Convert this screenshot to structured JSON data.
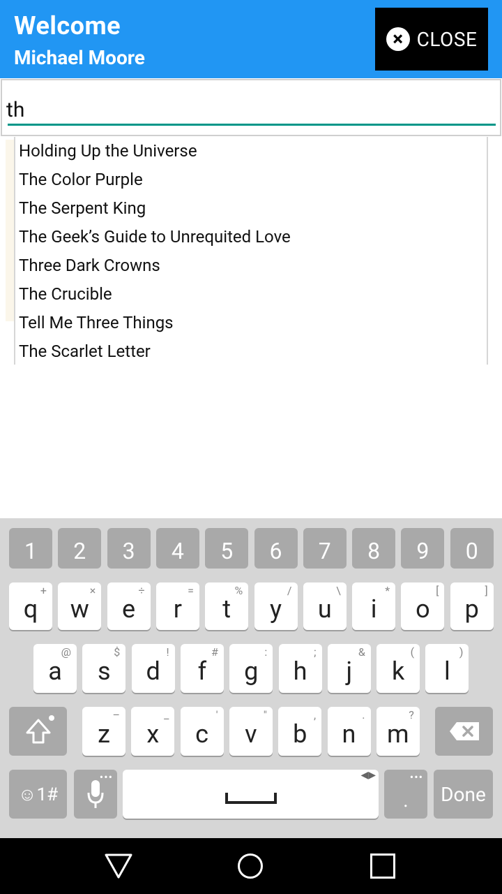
{
  "header": {
    "welcome": "Welcome",
    "username": "Michael Moore",
    "close_label": "CLOSE",
    "background": "#2196f3"
  },
  "search": {
    "value": "th",
    "accent": "#009688"
  },
  "suggestions": [
    "Holding Up the Universe",
    "The Color Purple",
    "The Serpent King",
    "The Geek’s Guide to Unrequited Love",
    "Three Dark Crowns",
    "The Crucible",
    "Tell Me Three Things",
    "The Scarlet Letter"
  ],
  "keyboard": {
    "numbers": [
      "1",
      "2",
      "3",
      "4",
      "5",
      "6",
      "7",
      "8",
      "9",
      "0"
    ],
    "row1": [
      {
        "k": "q",
        "h": "+"
      },
      {
        "k": "w",
        "h": "×"
      },
      {
        "k": "e",
        "h": "÷"
      },
      {
        "k": "r",
        "h": "="
      },
      {
        "k": "t",
        "h": "%"
      },
      {
        "k": "y",
        "h": "/"
      },
      {
        "k": "u",
        "h": "\\"
      },
      {
        "k": "i",
        "h": "*"
      },
      {
        "k": "o",
        "h": "["
      },
      {
        "k": "p",
        "h": "]"
      }
    ],
    "row2": [
      {
        "k": "a",
        "h": "@"
      },
      {
        "k": "s",
        "h": "$"
      },
      {
        "k": "d",
        "h": "!"
      },
      {
        "k": "f",
        "h": "#"
      },
      {
        "k": "g",
        "h": ":"
      },
      {
        "k": "h",
        "h": ";"
      },
      {
        "k": "j",
        "h": "&"
      },
      {
        "k": "k",
        "h": "("
      },
      {
        "k": "l",
        "h": ")"
      }
    ],
    "row3": [
      {
        "k": "z",
        "h": "–"
      },
      {
        "k": "x",
        "h": "_"
      },
      {
        "k": "c",
        "h": "'"
      },
      {
        "k": "v",
        "h": "\""
      },
      {
        "k": "b",
        "h": ","
      },
      {
        "k": "n",
        "h": "."
      },
      {
        "k": "m",
        "h": "?"
      }
    ],
    "symbols_label": "☺1#",
    "period_label": ".",
    "done_label": "Done"
  }
}
